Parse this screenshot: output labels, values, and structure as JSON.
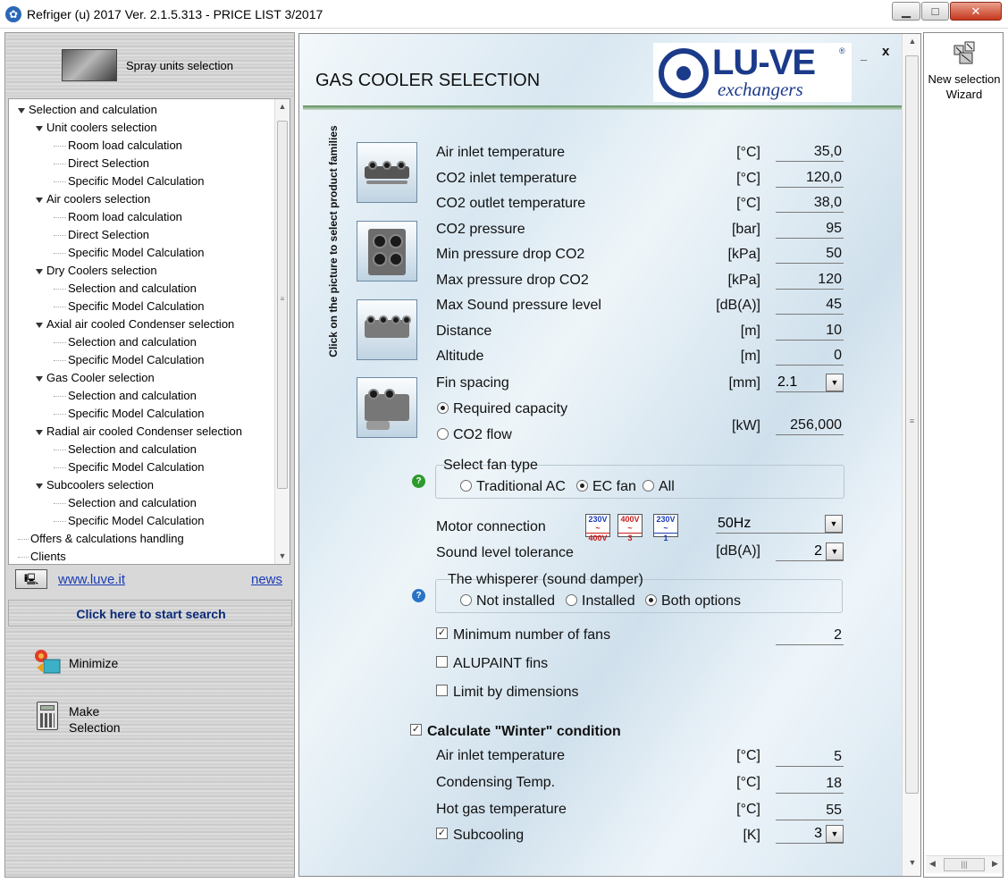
{
  "window": {
    "title": "Refriger (u) 2017 Ver. 2.1.5.313 - PRICE LIST 3/2017",
    "minimize_glyph": "▁",
    "maximize_glyph": "□",
    "close_glyph": "✕"
  },
  "sidebar": {
    "spray_label": "Spray units selection",
    "tree": [
      {
        "label": "Selection and calculation",
        "level": 0,
        "expanded": true
      },
      {
        "label": "Unit coolers selection",
        "level": 1,
        "expanded": true
      },
      {
        "label": "Room load calculation",
        "level": 2
      },
      {
        "label": "Direct Selection",
        "level": 2
      },
      {
        "label": "Specific Model Calculation",
        "level": 2
      },
      {
        "label": "Air coolers selection",
        "level": 1,
        "expanded": true
      },
      {
        "label": "Room load calculation",
        "level": 2
      },
      {
        "label": "Direct Selection",
        "level": 2
      },
      {
        "label": "Specific Model Calculation",
        "level": 2
      },
      {
        "label": "Dry Coolers selection",
        "level": 1,
        "expanded": true
      },
      {
        "label": "Selection and calculation",
        "level": 2
      },
      {
        "label": "Specific Model Calculation",
        "level": 2
      },
      {
        "label": "Axial air cooled Condenser selection",
        "level": 1,
        "expanded": true
      },
      {
        "label": "Selection and calculation",
        "level": 2
      },
      {
        "label": "Specific Model Calculation",
        "level": 2
      },
      {
        "label": "Gas Cooler selection",
        "level": 1,
        "expanded": true
      },
      {
        "label": "Selection and calculation",
        "level": 2
      },
      {
        "label": "Specific Model Calculation",
        "level": 2
      },
      {
        "label": "Radial  air cooled Condenser selection",
        "level": 1,
        "expanded": true
      },
      {
        "label": "Selection and calculation",
        "level": 2
      },
      {
        "label": "Specific Model Calculation",
        "level": 2
      },
      {
        "label": "Subcoolers selection",
        "level": 1,
        "expanded": true
      },
      {
        "label": "Selection and calculation",
        "level": 2
      },
      {
        "label": "Specific Model Calculation",
        "level": 2
      },
      {
        "label": "Offers & calculations handling",
        "level": 0
      },
      {
        "label": "Clients",
        "level": 0
      }
    ],
    "link_luve": "www.luve.it",
    "link_news": "news",
    "start_search": "Click here to start search",
    "minimize_label": "Minimize",
    "make_label_1": "Make",
    "make_label_2": "Selection"
  },
  "panel": {
    "title": "GAS COOLER SELECTION",
    "logo_word": "LU-VE",
    "logo_sub": "exchangers",
    "logo_reg": "®",
    "min_glyph": "_",
    "close_glyph": "x",
    "side_caption": "Click on the picture to select product families",
    "rows": [
      {
        "label": "Air inlet temperature",
        "unit": "[°C]",
        "value": "35,0"
      },
      {
        "label": "CO2 inlet temperature",
        "unit": "[°C]",
        "value": "120,0"
      },
      {
        "label": "CO2 outlet temperature",
        "unit": "[°C]",
        "value": "38,0"
      },
      {
        "label": "CO2 pressure",
        "unit": "[bar]",
        "value": "95"
      },
      {
        "label": "Min pressure drop CO2",
        "unit": "[kPa]",
        "value": "50"
      },
      {
        "label": "Max pressure drop CO2",
        "unit": "[kPa]",
        "value": "120"
      },
      {
        "label": "Max Sound pressure level",
        "unit": "[dB(A)]",
        "value": "45"
      },
      {
        "label": "Distance",
        "unit": "[m]",
        "value": "10"
      },
      {
        "label": "Altitude",
        "unit": "[m]",
        "value": "0"
      }
    ],
    "fin_spacing": {
      "label": "Fin spacing",
      "unit": "[mm]",
      "value": "2.1"
    },
    "capacity": {
      "required_label": "Required capacity",
      "co2_flow_label": "CO2 flow",
      "unit": "[kW]",
      "value": "256,000",
      "selected": "required"
    },
    "fan_type": {
      "title": "Select fan type",
      "options": [
        "Traditional AC",
        "EC fan",
        "All"
      ],
      "selected": "EC fan"
    },
    "motor": {
      "label": "Motor connection",
      "badges": [
        {
          "top": "230V",
          "mid": "~",
          "bot": "400V",
          "top_color": "#1a3cb5",
          "bot_color": "#c81e1e"
        },
        {
          "top": "400V",
          "mid": "~",
          "bot": "3",
          "top_color": "#c81e1e",
          "bot_color": "#c81e1e"
        },
        {
          "top": "230V",
          "mid": "~",
          "bot": "1",
          "top_color": "#1a3cb5",
          "bot_color": "#1a3cb5"
        }
      ],
      "frequency": "50Hz"
    },
    "sound_tolerance": {
      "label": "Sound level tolerance",
      "unit": "[dB(A)]",
      "value": "2"
    },
    "whisperer": {
      "title": "The whisperer (sound damper)",
      "options": [
        "Not installed",
        "Installed",
        "Both options"
      ],
      "selected": "Both options"
    },
    "min_fans": {
      "label": "Minimum number of fans",
      "checked": true,
      "value": "2"
    },
    "alupaint": {
      "label": "ALUPAINT fins",
      "checked": false
    },
    "limit_dims": {
      "label": "Limit by dimensions",
      "checked": false
    },
    "winter": {
      "label": "Calculate \"Winter\" condition",
      "checked": true,
      "rows": [
        {
          "label": "Air inlet temperature",
          "unit": "[°C]",
          "value": "5"
        },
        {
          "label": "Condensing Temp.",
          "unit": "[°C]",
          "value": "18"
        },
        {
          "label": "Hot gas temperature",
          "unit": "[°C]",
          "value": "55"
        }
      ],
      "subcooling": {
        "label": "Subcooling",
        "unit": "[K]",
        "value": "3",
        "checked": true
      }
    },
    "help_glyph": "?",
    "check_glyph": "✓",
    "dropdown_glyph": "▼"
  },
  "wizard": {
    "line1": "New selection",
    "line2": "Wizard"
  },
  "colors": {
    "accent_blue": "#1b3a8a",
    "link_blue": "#1a3cb5",
    "help_green": "#2c9a2c",
    "help_blue": "#2a73c7",
    "close_red": "#c7371d"
  }
}
